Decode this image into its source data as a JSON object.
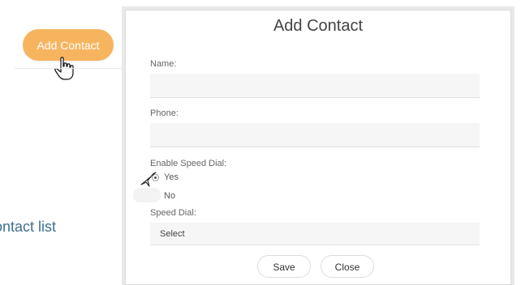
{
  "left_pane": {
    "add_contact_button_label": "Add Contact",
    "contact_list_text": "Contact list"
  },
  "dialog": {
    "title": "Add Contact",
    "fields": {
      "name_label": "Name:",
      "name_value": "",
      "phone_label": "Phone:",
      "phone_value": "",
      "speed_dial_toggle_label": "Enable Speed Dial:",
      "options": [
        {
          "label": "Yes",
          "selected": true
        },
        {
          "label": "No",
          "selected": false
        }
      ],
      "speed_dial_label": "Speed Dial:",
      "speed_dial_selected": "Select"
    },
    "buttons": {
      "save_label": "Save",
      "close_label": "Close"
    }
  },
  "colors": {
    "accent": "#f7b45f",
    "link": "#3f6f8f"
  },
  "icons": {
    "hand_cursor": "pointer-hand-icon",
    "arrow_cursor": "mouse-cursor-icon"
  }
}
